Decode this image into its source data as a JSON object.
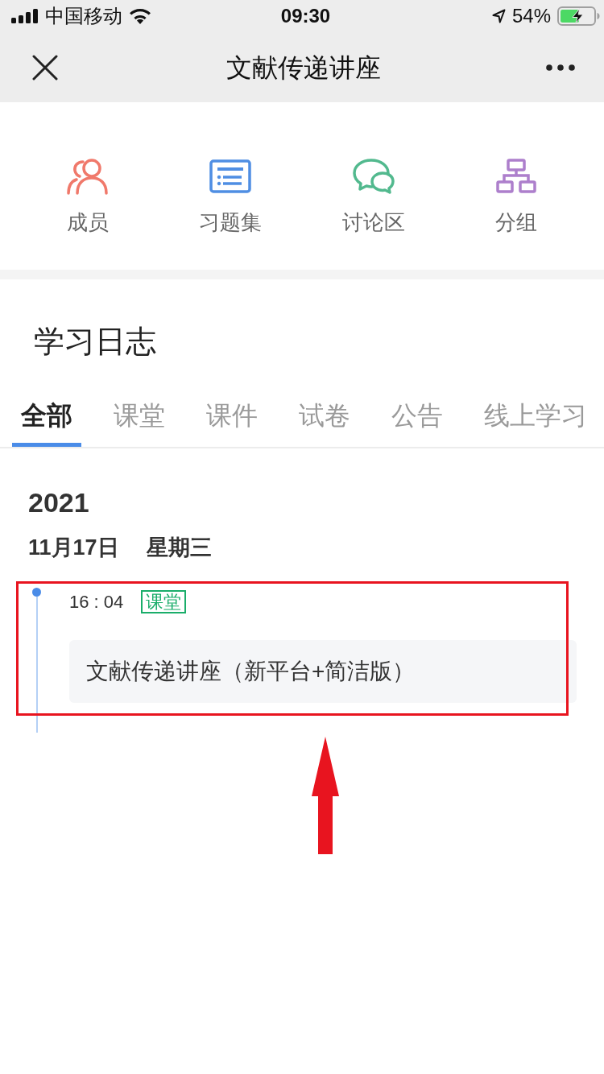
{
  "status_bar": {
    "carrier": "中国移动",
    "time": "09:30",
    "battery": "54%"
  },
  "nav_bar": {
    "title": "文献传递讲座"
  },
  "shortcuts": [
    {
      "kind": "members",
      "label": "成员",
      "color": "#f0796b"
    },
    {
      "kind": "exercises",
      "label": "习题集",
      "color": "#4f8ee3"
    },
    {
      "kind": "discussion",
      "label": "讨论区",
      "color": "#52b98e"
    },
    {
      "kind": "groups",
      "label": "分组",
      "color": "#ad7fcc"
    }
  ],
  "log": {
    "title": "学习日志",
    "tabs": [
      {
        "label": "全部",
        "selected": true
      },
      {
        "label": "课堂",
        "selected": false
      },
      {
        "label": "课件",
        "selected": false
      },
      {
        "label": "试卷",
        "selected": false
      },
      {
        "label": "公告",
        "selected": false
      },
      {
        "label": "线上学习",
        "selected": false
      }
    ]
  },
  "timeline": {
    "year": "2021",
    "days": [
      {
        "date": "11月17日",
        "weekday": "星期三",
        "entries": [
          {
            "time": "16 : 04",
            "tag": "课堂",
            "title": "文献传递讲座（新平台+简洁版）"
          }
        ]
      }
    ]
  }
}
